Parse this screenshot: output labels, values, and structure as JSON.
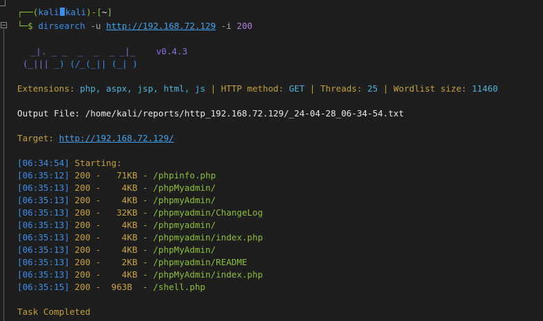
{
  "prompt": {
    "open": "┌──(",
    "user": "kali",
    "host": "kali",
    "mid": ")-[",
    "dir": "~",
    "close": "]",
    "lead": "└─$ ",
    "command": "dirsearch",
    "flag_u": "-u",
    "url": "http://192.168.72.129",
    "flag_i": "-i",
    "status_filter": "200"
  },
  "banner": {
    "logo_line1": " _|. _ _  _  _  _ _|_    ",
    "version": "v0.4.3",
    "logo_line2": "(_||| _) (/_(_|| (_| )"
  },
  "config": {
    "ext_label": "Extensions: ",
    "ext_value": "php, aspx, jsp, html, js",
    "sep": " | ",
    "method_label": "HTTP method: ",
    "method_value": "GET",
    "threads_label": "Threads: ",
    "threads_value": "25",
    "wordlist_label": "Wordlist size: ",
    "wordlist_value": "11460"
  },
  "output_file": {
    "label": "Output File: ",
    "value": "/home/kali/reports/http_192.168.72.129/_24-04-28_06-34-54.txt"
  },
  "target": {
    "label": "Target: ",
    "value": "http://192.168.72.129/"
  },
  "start": {
    "timestamp": "[06:34:54]",
    "text": " Starting:"
  },
  "results": [
    {
      "time": "[06:35:12]",
      "status": "200",
      "size": "  71KB",
      "path": "/phpinfo.php"
    },
    {
      "time": "[06:35:13]",
      "status": "200",
      "size": "   4KB",
      "path": "/phpMyadmin/"
    },
    {
      "time": "[06:35:13]",
      "status": "200",
      "size": "   4KB",
      "path": "/phpmyAdmin/"
    },
    {
      "time": "[06:35:13]",
      "status": "200",
      "size": "  32KB",
      "path": "/phpmyadmin/ChangeLog"
    },
    {
      "time": "[06:35:13]",
      "status": "200",
      "size": "   4KB",
      "path": "/phpmyadmin/"
    },
    {
      "time": "[06:35:13]",
      "status": "200",
      "size": "   4KB",
      "path": "/phpmyadmin/index.php"
    },
    {
      "time": "[06:35:13]",
      "status": "200",
      "size": "   4KB",
      "path": "/phpMyAdmin/"
    },
    {
      "time": "[06:35:13]",
      "status": "200",
      "size": "   2KB",
      "path": "/phpmyadmin/README"
    },
    {
      "time": "[06:35:13]",
      "status": "200",
      "size": "   4KB",
      "path": "/phpMyAdmin/index.php"
    },
    {
      "time": "[06:35:15]",
      "status": "200",
      "size": " 963B ",
      "path": "/shell.php"
    }
  ],
  "footer": {
    "text": "Task Completed"
  },
  "colors": {
    "background": "#1e1e1e",
    "timestamp": "#3b8eea",
    "status": "#c8a23a",
    "path": "#8cc034",
    "label": "#c8a23a",
    "value": "#4fb3d9"
  }
}
